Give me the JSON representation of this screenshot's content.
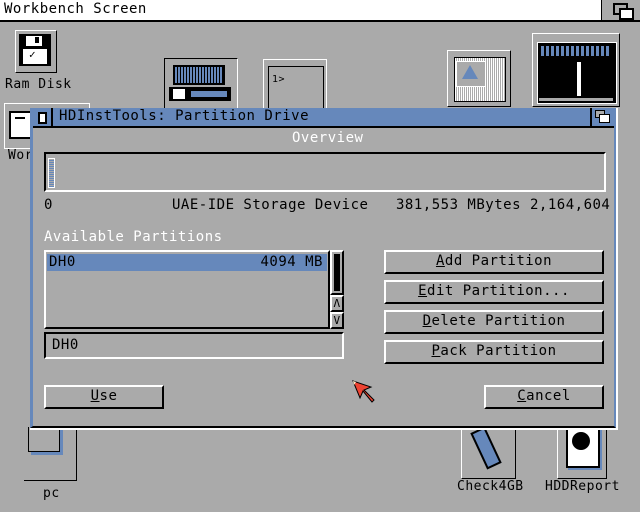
{
  "screen": {
    "title": "Workbench Screen"
  },
  "desktop_icons": [
    {
      "label": "Ram Disk"
    },
    {
      "label": "Wor"
    },
    {
      "label": "pc"
    },
    {
      "label": "Check4GB"
    },
    {
      "label": "HDDReport"
    }
  ],
  "window": {
    "title": "HDInstTools: Partition Drive",
    "overview_label": "Overview",
    "device": {
      "start": "0",
      "name": "UAE-IDE Storage Device",
      "size": "381,553 MBytes",
      "end": "2,164,604"
    },
    "partitions_label": "Available Partitions",
    "partitions": [
      {
        "name": "DH0",
        "size": "4094 MB",
        "selected": true
      }
    ],
    "selected_partition_field": "DH0",
    "buttons": {
      "add": {
        "hotkey": "A",
        "rest": "dd Partition"
      },
      "edit": {
        "hotkey": "E",
        "rest": "dit Partition..."
      },
      "delete": {
        "hotkey": "D",
        "rest": "elete Partition"
      },
      "pack": {
        "hotkey": "P",
        "rest": "ack Partition"
      },
      "use": {
        "hotkey": "U",
        "rest": "se"
      },
      "cancel": {
        "hotkey": "C",
        "rest": "ancel"
      }
    }
  },
  "colors": {
    "background": "#aaaaaa",
    "accent": "#6688bb",
    "pointer": "#ee4433"
  }
}
